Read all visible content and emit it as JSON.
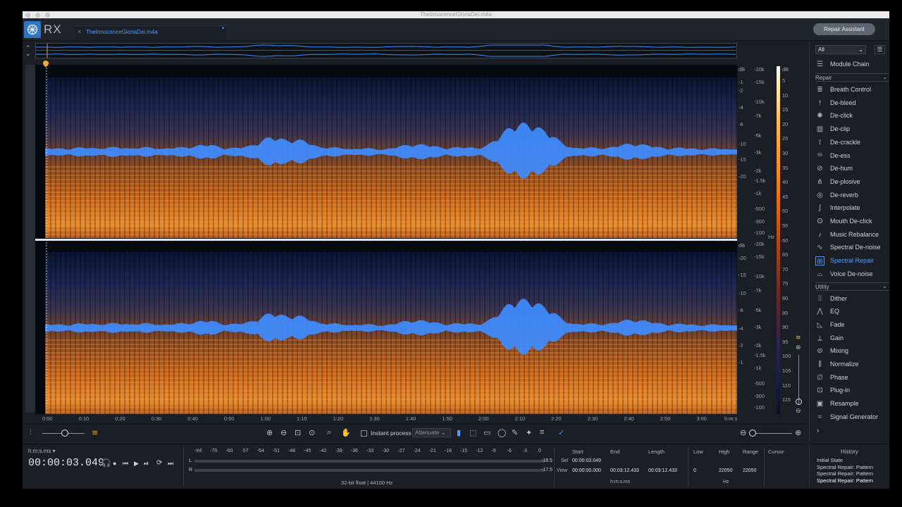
{
  "window": {
    "title": "TheInnocenceGloriaDei.m4a"
  },
  "app": {
    "logo_text": "RX",
    "file_tab": "TheInnocenceGloriaDei.m4a",
    "tab_modified": "•",
    "close_glyph": "×",
    "repair_assistant": "Repair Assistant"
  },
  "spectrogram": {
    "channel_left": "L",
    "channel_right": "R",
    "freq_ticks": [
      "-20k",
      "-15k",
      "-10k",
      "-7k",
      "-5k",
      "-3k",
      "-2k",
      "-1.5k",
      "-1k",
      "-500",
      "-300",
      "-100"
    ],
    "freq_unit": "Hz",
    "db_ticks": [
      "-1",
      "-2",
      "-4",
      "-6",
      "-10",
      "-15",
      "-20",
      "-20",
      "-15",
      "-10",
      "-6",
      "-4",
      "-2",
      "-1"
    ],
    "db_unit": "dB",
    "colorbar_ticks": [
      "5",
      "10",
      "15",
      "20",
      "25",
      "30",
      "35",
      "40",
      "45",
      "50",
      "55",
      "60",
      "65",
      "70",
      "75",
      "80",
      "85",
      "90",
      "95",
      "100",
      "105",
      "110",
      "115"
    ],
    "colorbar_unit": "dB",
    "time_ticks": [
      "0:00",
      "0:10",
      "0:20",
      "0:30",
      "0:40",
      "0:50",
      "1:00",
      "1:10",
      "1:20",
      "1:30",
      "1:40",
      "1:50",
      "2:00",
      "2:10",
      "2:20",
      "2:30",
      "2:40",
      "2:50",
      "3:00"
    ],
    "time_unit": "h:m:s",
    "colors": {
      "waveform": "#3f8cff",
      "spectrum_hot": "#f08a2a",
      "spectrum_cool": "#1c2d5a"
    }
  },
  "toolbar": {
    "instant_process": "Instant process",
    "attenuate": "Attenuate",
    "icons": [
      "zoom-in-icon",
      "zoom-out-icon",
      "zoom-selection-icon",
      "zoom-fit-icon",
      "magnify-icon",
      "hand-icon",
      "time-select-icon",
      "rect-select-icon",
      "lasso-icon",
      "brush-icon",
      "magic-wand-icon",
      "harmonic-icon",
      "spectral-repair-icon"
    ]
  },
  "transport": {
    "time_format": "h:m:s.ms",
    "timecode": "00:00:03.049",
    "meter_scale": [
      "-Inf.",
      "-70",
      "-60",
      "-57",
      "-54",
      "-51",
      "-48",
      "-45",
      "-42",
      "-39",
      "-36",
      "-33",
      "-30",
      "-27",
      "-24",
      "-21",
      "-18",
      "-15",
      "-12",
      "-9",
      "-6",
      "-3",
      "0"
    ],
    "meter_left_label": "L",
    "meter_right_label": "R",
    "meter_left_value": "-18.5",
    "meter_right_value": "-17.5",
    "format": "32-bit float | 44100 Hz"
  },
  "selection": {
    "start_label": "Start",
    "end_label": "End",
    "length_label": "Length",
    "sel_label": "Sel",
    "view_label": "View",
    "sel_start": "00:00:03.049",
    "view_start": "00:00:00.000",
    "view_end": "00:03:12.433",
    "view_length": "00:03:12.433",
    "unit": "h:m:s.ms",
    "low_label": "Low",
    "high_label": "High",
    "range_label": "Range",
    "low": "0",
    "high": "22050",
    "range": "22050",
    "freq_unit": "Hz",
    "cursor_label": "Cursor"
  },
  "panel": {
    "filter": "All",
    "module_chain": "Module Chain",
    "repair_section": "Repair",
    "repair_modules": [
      "Breath Control",
      "De-bleed",
      "De-click",
      "De-clip",
      "De-crackle",
      "De-ess",
      "De-hum",
      "De-plosive",
      "De-reverb",
      "Interpolate",
      "Mouth De-click",
      "Music Rebalance",
      "Spectral De-noise",
      "Spectral Repair",
      "Voice De-noise"
    ],
    "utility_section": "Utility",
    "utility_modules": [
      "Dither",
      "EQ",
      "Fade",
      "Gain",
      "Mixing",
      "Normalize",
      "Phase",
      "Plug-in",
      "Resample",
      "Signal Generator"
    ],
    "active_module": "Spectral Repair"
  },
  "history": {
    "title": "History",
    "items": [
      "Initial State",
      "Spectral Repair: Pattern",
      "Spectral Repair: Pattern",
      "Spectral Repair: Pattern"
    ]
  }
}
